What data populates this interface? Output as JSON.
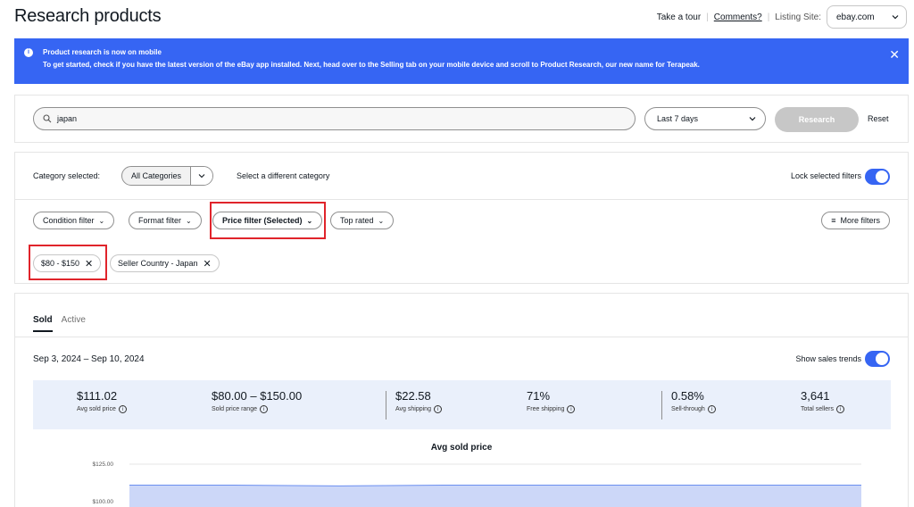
{
  "header": {
    "title": "Research products",
    "take_tour": "Take a tour",
    "separator": "|",
    "comments": "Comments?",
    "listing_site_label": "Listing Site:",
    "listing_site_value": "ebay.com"
  },
  "banner": {
    "title": "Product research is now on mobile",
    "text": "To get started, check if you have the latest version of the eBay app installed. Next, head over to the Selling tab on your mobile device and scroll to Product Research, our new name for Terapeak.",
    "close": "✕",
    "background": "#3665f3"
  },
  "search": {
    "query": "japan",
    "date_range": "Last 7 days",
    "research_label": "Research",
    "reset_label": "Reset"
  },
  "filters": {
    "category_label": "Category selected:",
    "category_value": "All Categories",
    "change_category": "Select a different category",
    "lock_label": "Lock selected filters",
    "lock_on": true,
    "pills": [
      {
        "label": "Condition filter"
      },
      {
        "label": "Format filter"
      },
      {
        "label": "Price filter (Selected)"
      },
      {
        "label": "Top rated"
      }
    ],
    "more_filters": "More filters",
    "chips": [
      {
        "label": "$80 - $150"
      },
      {
        "label": "Seller Country - Japan"
      }
    ],
    "highlight_color": "#e0242b"
  },
  "results": {
    "tabs": [
      "Sold",
      "Active"
    ],
    "active_tab": "Sold",
    "date_range": "Sep 3, 2024 – Sep 10, 2024",
    "trends_label": "Show sales trends",
    "trends_on": true,
    "stats": [
      {
        "value": "$111.02",
        "label": "Avg sold price"
      },
      {
        "value": "$80.00 – $150.00",
        "label": "Sold price range"
      },
      {
        "value": "$22.58",
        "label": "Avg shipping"
      },
      {
        "value": "71%",
        "label": "Free shipping"
      },
      {
        "value": "0.58%",
        "label": "Sell-through"
      },
      {
        "value": "3,641",
        "label": "Total sellers"
      }
    ]
  },
  "chart_data": {
    "type": "area",
    "title": "Avg sold price",
    "y_ticks": [
      "$125.00",
      "$100.00"
    ],
    "ylim": [
      100,
      125
    ],
    "values": [
      111,
      111,
      110.5,
      111,
      111,
      111,
      111,
      111
    ],
    "fill_color": "#ccd7f8",
    "line_color": "#6b8ff0"
  }
}
